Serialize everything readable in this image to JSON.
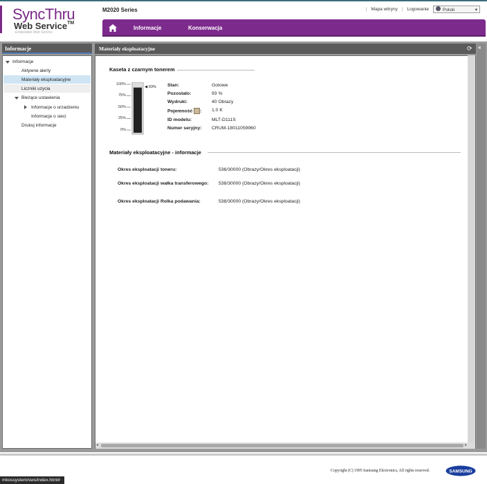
{
  "header": {
    "logo_main": "SyncThru",
    "logo_sub": "Web Service",
    "logo_tm": "TM",
    "logo_tagline": "Embedded Web Service",
    "model": "M2020 Series",
    "sitemap_label": "Mapa witryny",
    "login_label": "Logowanie",
    "language": "Polski",
    "accent_color": "#7d2a8d"
  },
  "nav": {
    "home_icon": "home-icon",
    "items": [
      "Informacje",
      "Konserwacja"
    ]
  },
  "sidebar": {
    "title": "Informacje",
    "items": [
      {
        "label": "Informacje",
        "level": 0,
        "state": "expanded"
      },
      {
        "label": "Aktywne alerty",
        "level": 1
      },
      {
        "label": "Materiały eksploatacyjne",
        "level": 1,
        "selected": true
      },
      {
        "label": "Liczniki uzycia",
        "level": 1
      },
      {
        "label": "Bieżące ustawienia",
        "level": 1,
        "state": "expanded"
      },
      {
        "label": "Informacje o urzadzeniu",
        "level": 2,
        "state": "collapsed"
      },
      {
        "label": "Informacje o sieci",
        "level": 2
      },
      {
        "label": "Drukuj informacje",
        "level": 1
      }
    ]
  },
  "content": {
    "title": "Materiały eksploatacyjne",
    "toner": {
      "section_title": "Kaseta z czarnym tonerem",
      "gauge_ticks": [
        "100%",
        "75%",
        "50%",
        "25%",
        "0%"
      ],
      "level_percent": 93,
      "level_label": "93%",
      "fields": [
        {
          "label": "Stan:",
          "value": "Gotowe"
        },
        {
          "label": "Pozostało:",
          "value": "93 %"
        },
        {
          "label": "Wydruki:",
          "value": "40 Obrazy"
        },
        {
          "label": "Pojemność",
          "value": "1.0 K"
        },
        {
          "label": "ID modelu:",
          "value": "MLT-D111S"
        },
        {
          "label": "Numer seryjny:",
          "value": "CRUM-18011059960"
        }
      ],
      "capacity_colon": ":"
    },
    "lifetime": {
      "section_title": "Materiały eksploatacyjne - informacje",
      "rows": [
        {
          "label": "Okres eksploatacji toneru:",
          "value": "536/30000 (Obrazy/Okres eksploatacji)"
        },
        {
          "label": "Okres eksploatacji wałka transferowego:",
          "value": "538/30000 (Obrazy/Okres eksploatacji)"
        },
        {
          "label": "Okres eksploatacji Rolka podawania:",
          "value": "538/30000 (Obrazy/Okres eksploatacji)"
        }
      ]
    }
  },
  "footer": {
    "copyright": "Copyright (C) 1995 Samsung Electronics, All rights reserved.",
    "brand": "SAMSUNG",
    "status_url": "mkossystem/sws/index.html#"
  }
}
